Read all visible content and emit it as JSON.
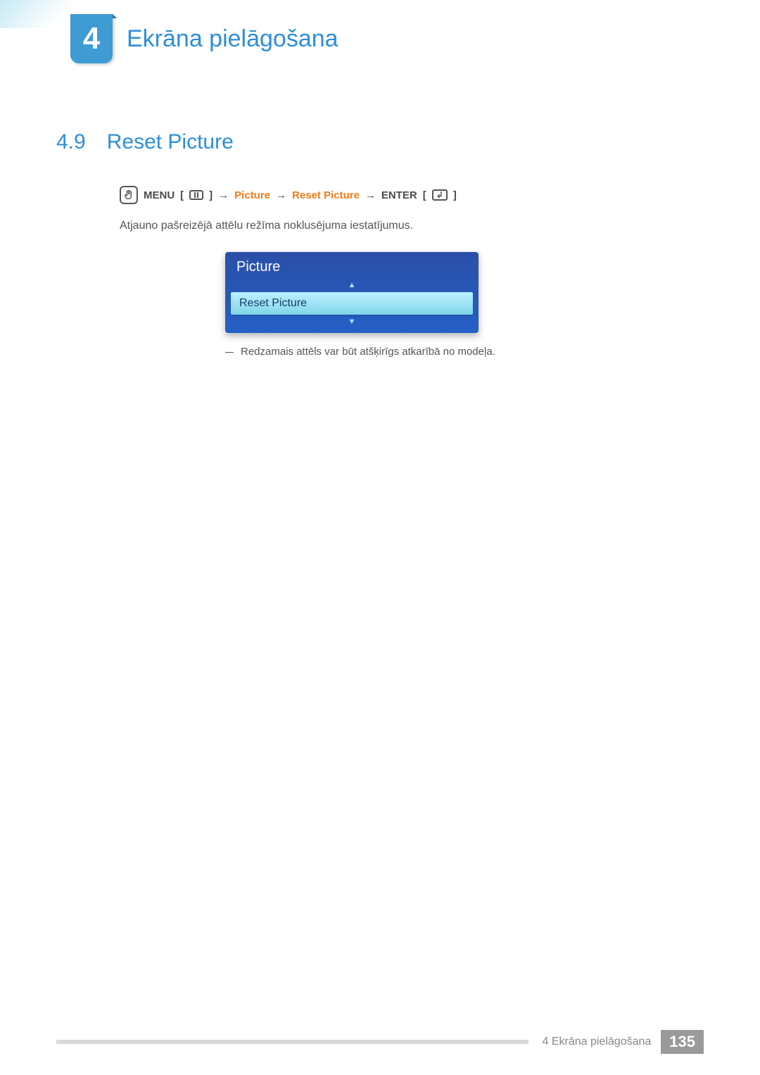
{
  "chapter": {
    "number": "4",
    "title": "Ekrāna pielāgošana"
  },
  "section": {
    "number": "4.9",
    "title": "Reset Picture"
  },
  "nav": {
    "menu_label": "MENU",
    "arrow": "→",
    "step1": "Picture",
    "step2": "Reset Picture",
    "enter_label": "ENTER"
  },
  "body": {
    "description": "Atjauno pašreizējā attēlu režīma noklusējuma iestatījumus."
  },
  "osd": {
    "header": "Picture",
    "item": "Reset Picture",
    "up": "▲",
    "down": "▼"
  },
  "note": "Redzamais attēls var būt atšķirīgs atkarībā no modeļa.",
  "footer": {
    "label": "4 Ekrāna pielāgošana",
    "page": "135"
  }
}
